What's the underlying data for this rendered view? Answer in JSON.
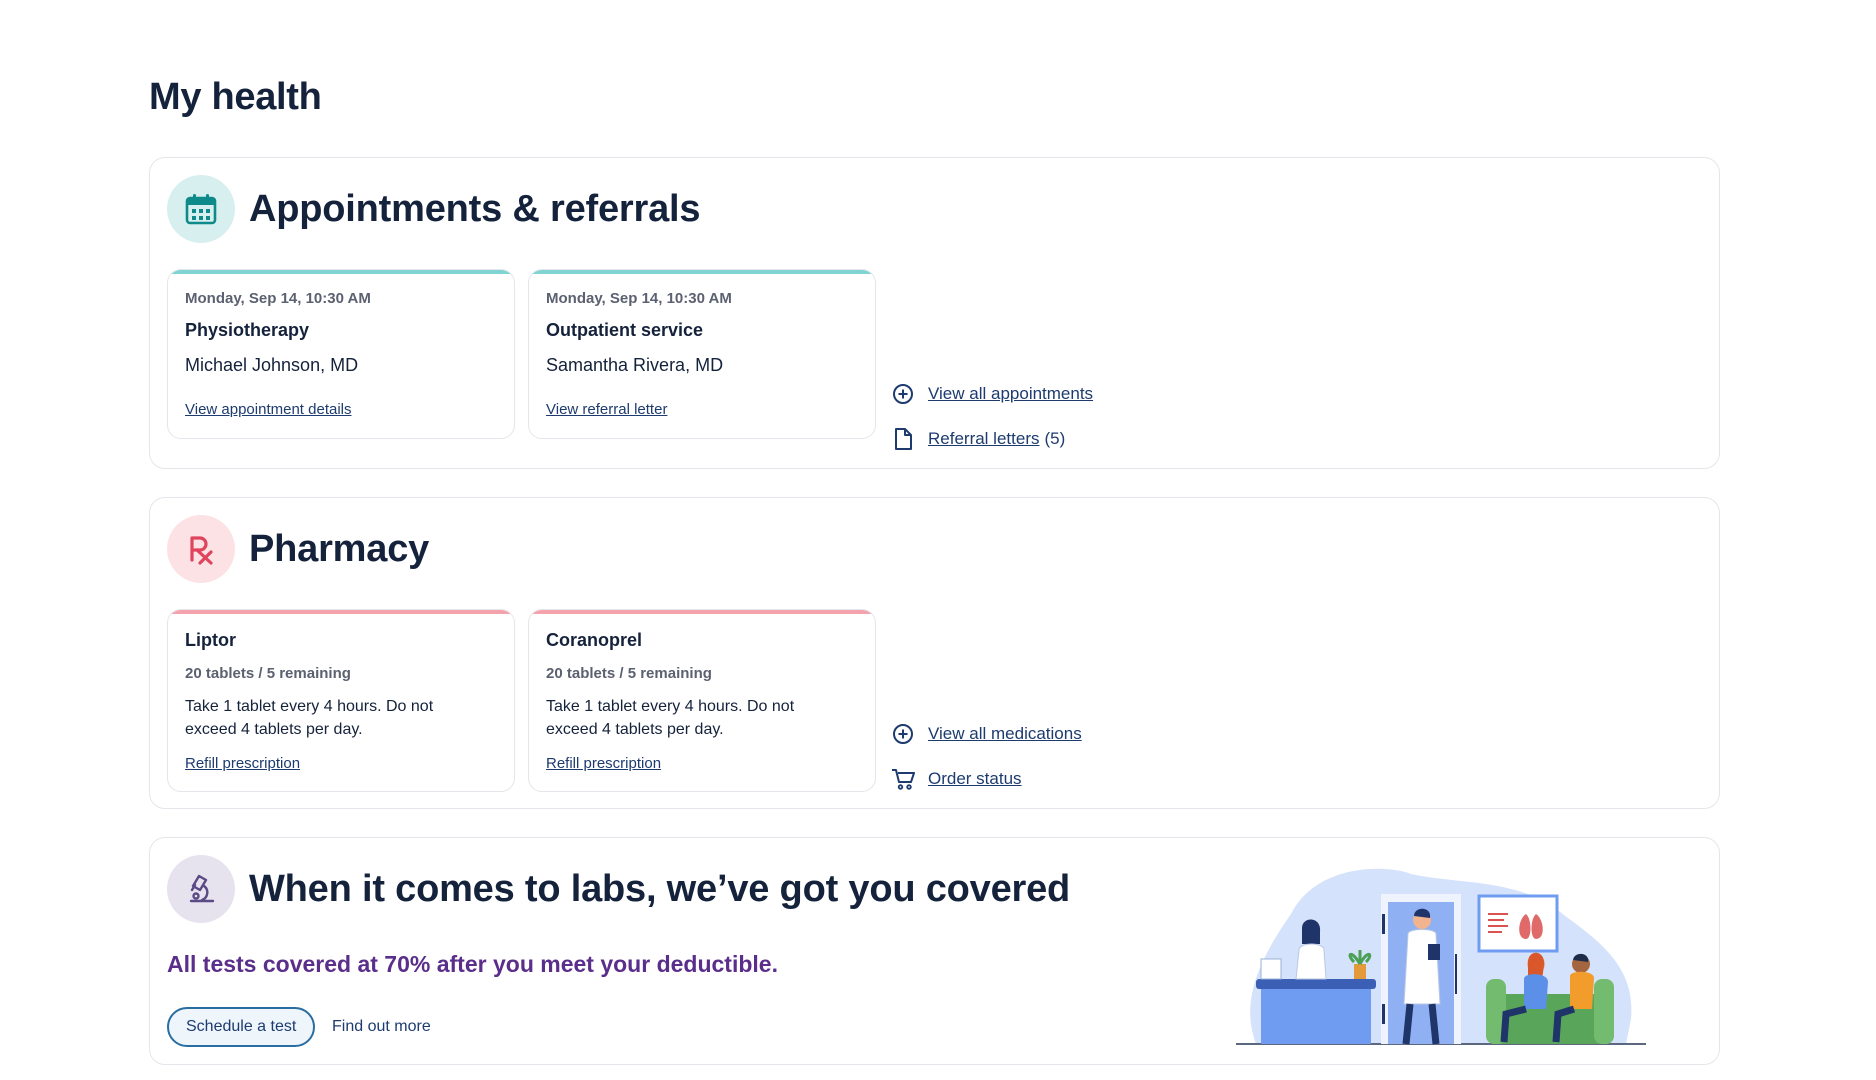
{
  "page": {
    "title": "My health"
  },
  "appointments": {
    "title": "Appointments & referrals",
    "icon": "calendar-icon",
    "accent": "#7fd3d0",
    "cards": [
      {
        "date": "Monday, Sep 14, 10:30 AM",
        "title": "Physiotherapy",
        "doctor": "Michael Johnson, MD",
        "link": "View appointment details"
      },
      {
        "date": "Monday, Sep 14, 10:30 AM",
        "title": "Outpatient service",
        "doctor": "Samantha Rivera, MD",
        "link": "View referral letter"
      }
    ],
    "links": [
      {
        "label": "View all appointments",
        "icon": "plus-circle-icon",
        "count": ""
      },
      {
        "label": "Referral letters",
        "icon": "document-icon",
        "count": "(5)"
      }
    ]
  },
  "pharmacy": {
    "title": "Pharmacy",
    "icon": "rx-icon",
    "accent": "#f4a3ad",
    "cards": [
      {
        "title": "Liptor",
        "qty": "20 tablets / 5 remaining",
        "desc": "Take 1 tablet every 4 hours. Do not exceed 4 tablets per day.",
        "link": "Refill prescription"
      },
      {
        "title": "Coranoprel",
        "qty": "20 tablets / 5 remaining",
        "desc": "Take 1 tablet every 4 hours. Do not exceed 4 tablets per day.",
        "link": "Refill prescription"
      }
    ],
    "links": [
      {
        "label": "View all medications",
        "icon": "plus-circle-icon"
      },
      {
        "label": "Order status",
        "icon": "cart-icon"
      }
    ]
  },
  "labs": {
    "title": "When it comes to labs, we’ve got you covered",
    "icon": "microscope-icon",
    "subtitle": "All tests covered at 70% after you meet your deductible.",
    "primary_button": "Schedule a test",
    "secondary_button": "Find out more"
  }
}
